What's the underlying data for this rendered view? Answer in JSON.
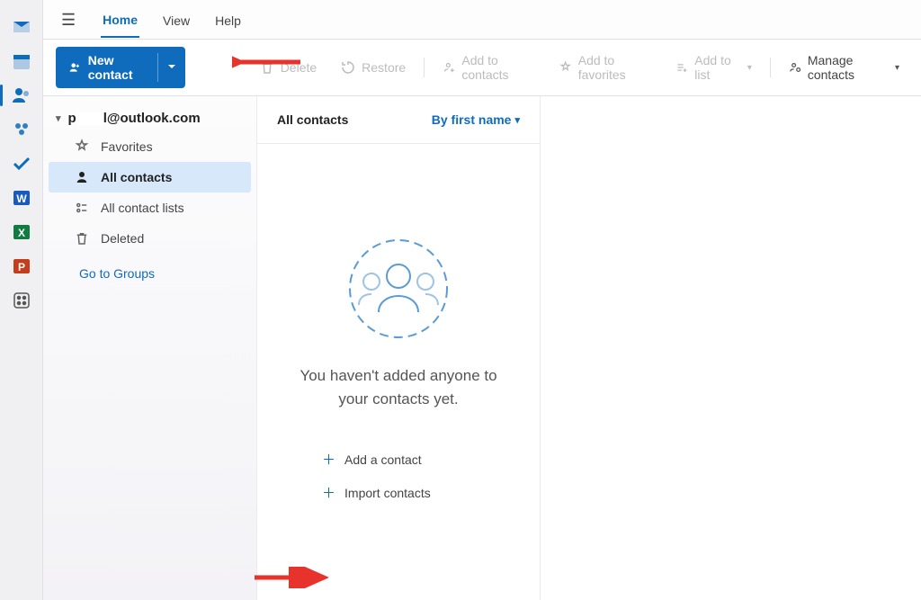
{
  "tabs": {
    "home": "Home",
    "view": "View",
    "help": "Help"
  },
  "toolbar": {
    "new_contact": "New contact",
    "delete": "Delete",
    "restore": "Restore",
    "add_contacts": "Add to contacts",
    "add_favorites": "Add to favorites",
    "add_to_list": "Add to list",
    "manage_contacts": "Manage contacts"
  },
  "account": {
    "email_prefix": "p",
    "email_suffix": "l@outlook.com"
  },
  "nav": {
    "favorites": "Favorites",
    "all_contacts": "All contacts",
    "all_lists": "All contact lists",
    "deleted": "Deleted",
    "groups_link": "Go to Groups"
  },
  "list": {
    "title": "All contacts",
    "sort": "By first name"
  },
  "empty": {
    "message": "You haven't added anyone to your contacts yet.",
    "add": "Add a contact",
    "import": "Import contacts"
  }
}
